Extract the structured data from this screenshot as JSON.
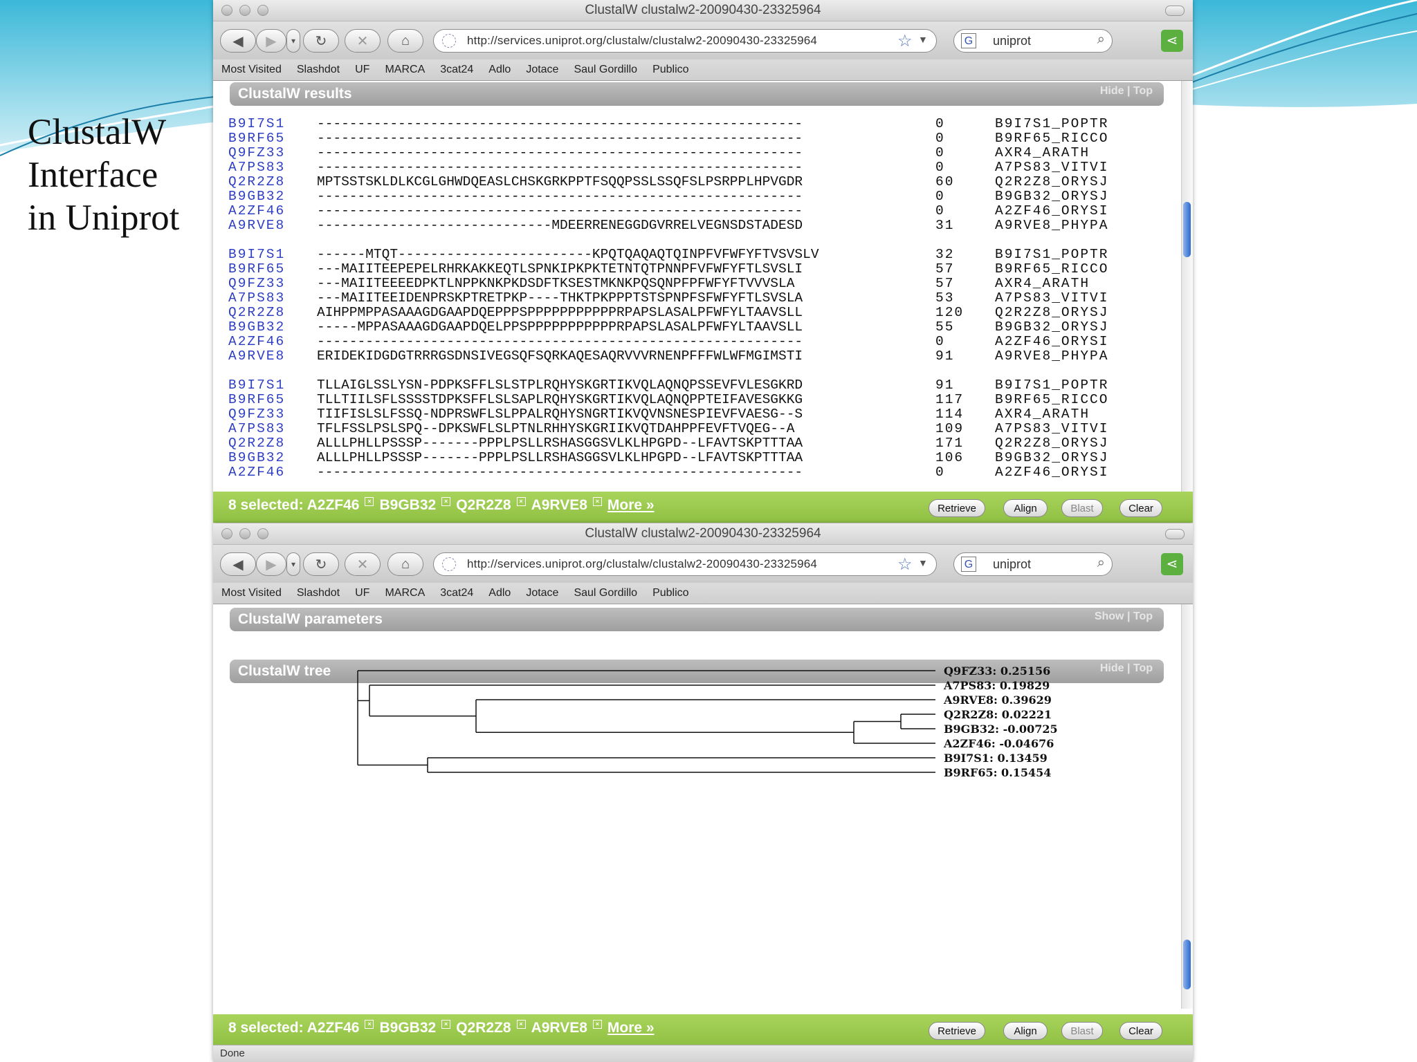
{
  "slide": {
    "title": "ClustalW\nInterface\nin Uniprot"
  },
  "browser": {
    "window_title": "ClustalW clustalw2-20090430-23325964",
    "url": "http://services.uniprot.org/clustalw/clustalw2-20090430-23325964",
    "search_value": "uniprot",
    "search_engine_letter": "G",
    "bookmarks": [
      "Most Visited",
      "Slashdot",
      "UF",
      "MARCA",
      "3cat24",
      "Adlo",
      "Jotace",
      "Saul Gordillo",
      "Publico"
    ],
    "status": "Done"
  },
  "results": {
    "title": "ClustalW results",
    "links": "Hide | Top",
    "blocks": [
      [
        {
          "id": "B9I7S1",
          "seq": "------------------------------------------------------------",
          "num": "0",
          "name": "B9I7S1_POPTR"
        },
        {
          "id": "B9RF65",
          "seq": "------------------------------------------------------------",
          "num": "0",
          "name": "B9RF65_RICCO"
        },
        {
          "id": "Q9FZ33",
          "seq": "------------------------------------------------------------",
          "num": "0",
          "name": "AXR4_ARATH"
        },
        {
          "id": "A7PS83",
          "seq": "------------------------------------------------------------",
          "num": "0",
          "name": "A7PS83_VITVI"
        },
        {
          "id": "Q2R2Z8",
          "seq": "MPTSSTSKLDLKCGLGHWDQEASLCHSKGRKPPTFSQQPSSLSSQFSLPSRPPLHPVGDR",
          "num": "60",
          "name": "Q2R2Z8_ORYSJ"
        },
        {
          "id": "B9GB32",
          "seq": "------------------------------------------------------------",
          "num": "0",
          "name": "B9GB32_ORYSJ"
        },
        {
          "id": "A2ZF46",
          "seq": "------------------------------------------------------------",
          "num": "0",
          "name": "A2ZF46_ORYSI"
        },
        {
          "id": "A9RVE8",
          "seq": "-----------------------------MDEERRENEGGDGVRRELVEGNSDSTADESD",
          "num": "31",
          "name": "A9RVE8_PHYPA"
        }
      ],
      [
        {
          "id": "B9I7S1",
          "seq": "------MTQT------------------------KPQTQAQAQTQINPFVFWFYFTVSVSLV",
          "num": "32",
          "name": "B9I7S1_POPTR"
        },
        {
          "id": "B9RF65",
          "seq": "---MAIITEEPEPELRHRKAKKEQTLSPNKIPKPKTETNTQTPNNPFVFWFYFTLSVSLI",
          "num": "57",
          "name": "B9RF65_RICCO"
        },
        {
          "id": "Q9FZ33",
          "seq": "---MAIITEEEEDPKTLNPPKNKPKDSDFTKSESTMKNKPQSQNPFPFWFYFTVVVSLA",
          "num": "57",
          "name": "AXR4_ARATH"
        },
        {
          "id": "A7PS83",
          "seq": "---MAIITEEIDENPRSKPTRETPKP----THKTPKPPPTSTSPNPFSFWFYFTLSVSLA",
          "num": "53",
          "name": "A7PS83_VITVI"
        },
        {
          "id": "Q2R2Z8",
          "seq": "AIHPPMPPASAAAGDGAAPDQEPPPSPPPPPPPPPPPRPAPSLASALPFWFYLTAAVSLL",
          "num": "120",
          "name": "Q2R2Z8_ORYSJ"
        },
        {
          "id": "B9GB32",
          "seq": "-----MPPASAAAGDGAAPDQELPPSPPPPPPPPPPPRPAPSLASALPFWFYLTAAVSLL",
          "num": "55",
          "name": "B9GB32_ORYSJ"
        },
        {
          "id": "A2ZF46",
          "seq": "------------------------------------------------------------",
          "num": "0",
          "name": "A2ZF46_ORYSI"
        },
        {
          "id": "A9RVE8",
          "seq": "ERIDEKIDGDGTRRRGSDNSIVEGSQFSQRKAQESAQRVVVRNENPFFFWLWFMGIMSTI",
          "num": "91",
          "name": "A9RVE8_PHYPA"
        }
      ],
      [
        {
          "id": "B9I7S1",
          "seq": "TLLAIGLSSLYSN-PDPKSFFLSLSTPLRQHYSKGRTIKVQLAQNQPSSEVFVLESGKRD",
          "num": "91",
          "name": "B9I7S1_POPTR"
        },
        {
          "id": "B9RF65",
          "seq": "TLLTIILSFLSSSSTDPKSFFLSLSAPLRQHYSKGRTIKVQLAQNQPPTEIFAVESGKKG",
          "num": "117",
          "name": "B9RF65_RICCO"
        },
        {
          "id": "Q9FZ33",
          "seq": "TIIFISLSLFSSQ-NDPRSWFLSLPPALRQHYSNGRTIKVQVNSNESPIEVFVAESG--S",
          "num": "114",
          "name": "AXR4_ARATH"
        },
        {
          "id": "A7PS83",
          "seq": "TFLFSSLPSLSPQ--DPKSWFLSLPTNLRHHYSKGRIIKVQTDAHPPFEVFTVQEG--A",
          "num": "109",
          "name": "A7PS83_VITVI"
        },
        {
          "id": "Q2R2Z8",
          "seq": "ALLLPHLLPSSSP-------PPPLPSLLRSHASGGSVLKLHPGPD--LFAVTSKPTTTAA",
          "num": "171",
          "name": "Q2R2Z8_ORYSJ"
        },
        {
          "id": "B9GB32",
          "seq": "ALLLPHLLPSSSP-------PPPLPSLLRSHASGGSVLKLHPGPD--LFAVTSKPTTTAA",
          "num": "106",
          "name": "B9GB32_ORYSJ"
        },
        {
          "id": "A2ZF46",
          "seq": "------------------------------------------------------------",
          "num": "0",
          "name": "A2ZF46_ORYSI"
        }
      ]
    ]
  },
  "selection": {
    "count_label": "8 selected:",
    "items": [
      "A2ZF46",
      "B9GB32",
      "Q2R2Z8",
      "A9RVE8"
    ],
    "more": "More »",
    "buttons": {
      "retrieve": "Retrieve",
      "align": "Align",
      "blast": "Blast",
      "clear": "Clear"
    }
  },
  "parameters": {
    "title": "ClustalW parameters",
    "links": "Show | Top"
  },
  "tree": {
    "title": "ClustalW tree",
    "links": "Hide | Top",
    "leaves": [
      {
        "label": "Q9FZ33: 0.25156"
      },
      {
        "label": "A7PS83: 0.19829"
      },
      {
        "label": "A9RVE8: 0.39629"
      },
      {
        "label": "Q2R2Z8: 0.02221"
      },
      {
        "label": "B9GB32: -0.00725"
      },
      {
        "label": "A2ZF46: -0.04676"
      },
      {
        "label": "B9I7S1: 0.13459"
      },
      {
        "label": "B9RF65: 0.15454"
      }
    ]
  },
  "colors": {
    "accent_green": "#99c84c",
    "id_blue": "#2e3fc4",
    "header_gray": "#a8a8a8"
  }
}
